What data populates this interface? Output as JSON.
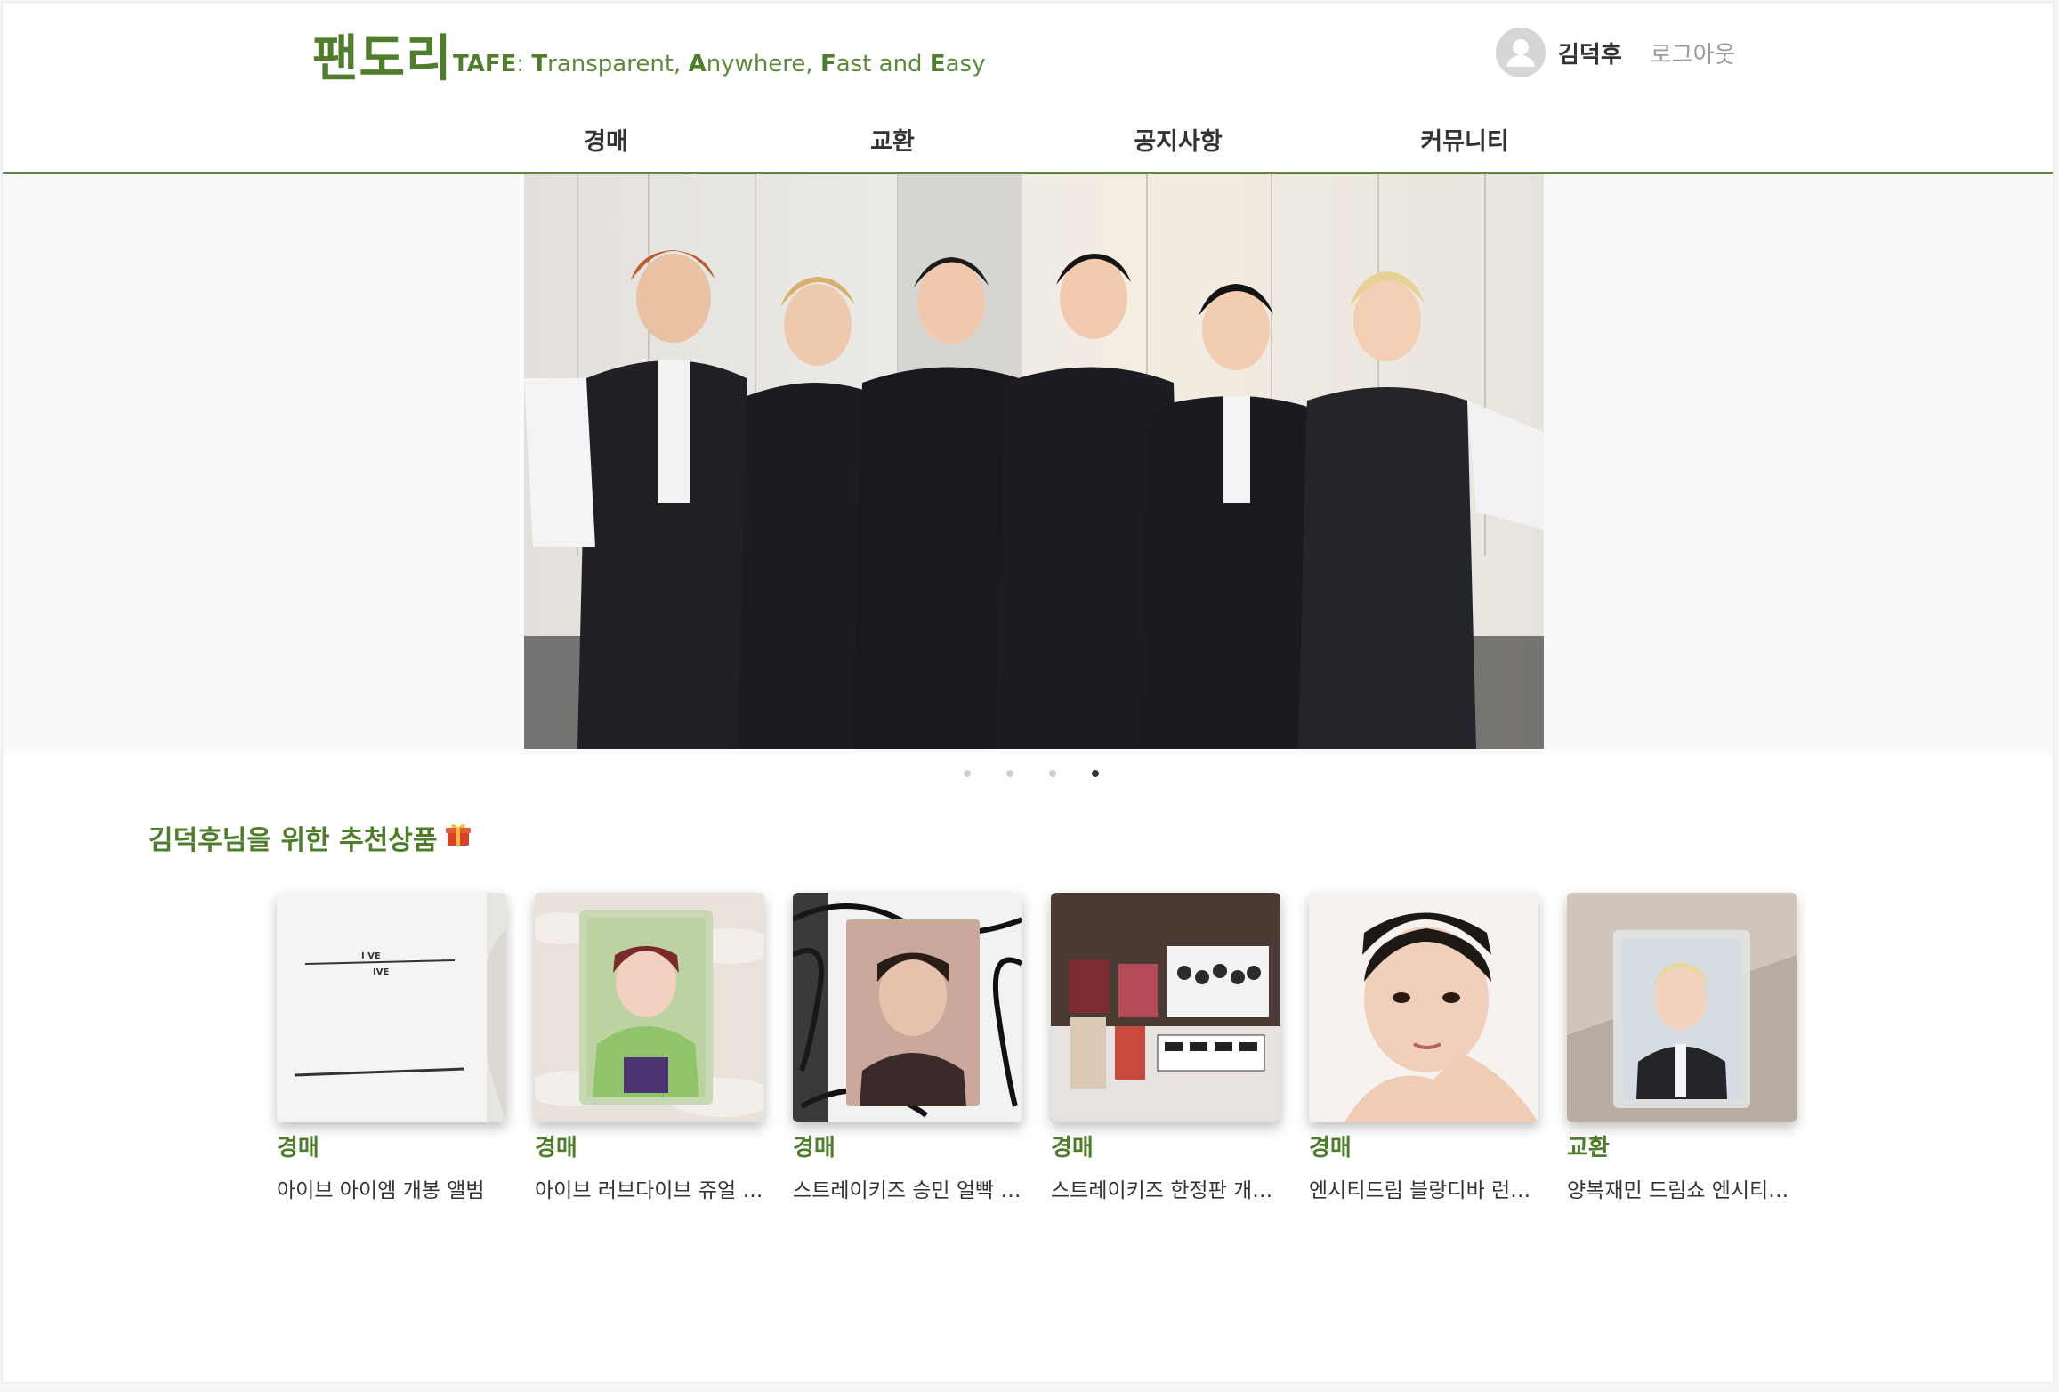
{
  "header": {
    "logo": "팬도리",
    "tagline": [
      {
        "init": "TAFE",
        "rest": ": "
      },
      {
        "init": "T",
        "rest": "ransparent, "
      },
      {
        "init": "A",
        "rest": "nywhere, "
      },
      {
        "init": "F",
        "rest": "ast and "
      },
      {
        "init": "E",
        "rest": "asy"
      }
    ],
    "user_name": "김덕후",
    "logout_label": "로그아웃"
  },
  "nav": {
    "items": [
      "경매",
      "교환",
      "공지사항",
      "커뮤니티"
    ]
  },
  "banner": {
    "slide_count": 4,
    "active_slide": 4
  },
  "recommend": {
    "title": "김덕후님을 위한 추천상품",
    "products": [
      {
        "type": "경매",
        "name": "아이브 아이엠 개봉 앨범"
      },
      {
        "type": "경매",
        "name": "아이브 러브다이브 쥬얼 …"
      },
      {
        "type": "경매",
        "name": "스트레이키즈 승민 얼빡 …"
      },
      {
        "type": "경매",
        "name": "스트레이키즈 한정판 개…"
      },
      {
        "type": "경매",
        "name": "엔시티드림 블랑디바 런…"
      },
      {
        "type": "교환",
        "name": "양복재민 드림쇼 엔시티…"
      }
    ]
  },
  "colors": {
    "brand_green": "#4f7d2c",
    "header_rule": "#5a8a3c"
  },
  "icons": {
    "avatar": "user-avatar-icon",
    "gift": "gift-icon"
  }
}
